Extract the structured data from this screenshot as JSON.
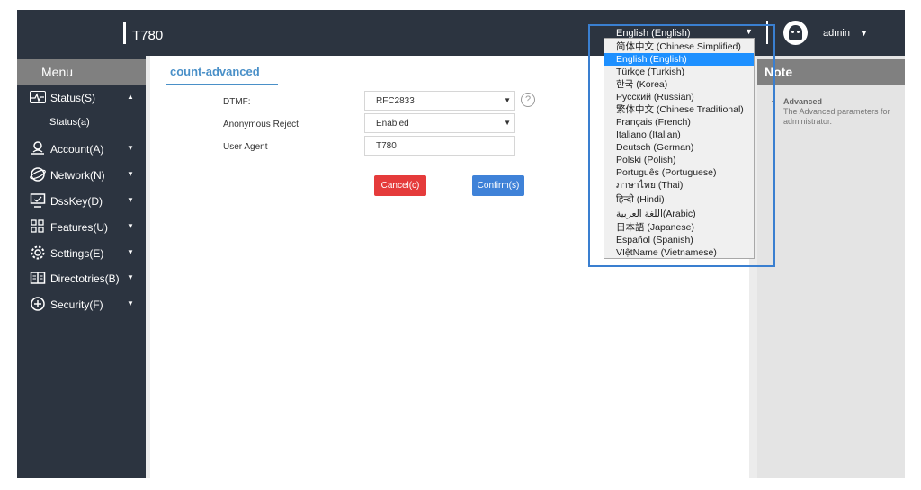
{
  "header": {
    "title": "T780",
    "language_selected": "English (English)",
    "user": "admin",
    "caret": "▼"
  },
  "sidebar": {
    "menu_title": "Menu",
    "items": [
      {
        "label": "Status(S)",
        "icon": "status-monitor-icon",
        "caret": "▲"
      },
      {
        "label": "Account(A)",
        "icon": "user-account-icon",
        "caret": "▼"
      },
      {
        "label": "Network(N)",
        "icon": "network-globe-icon",
        "caret": "▼"
      },
      {
        "label": "DssKey(D)",
        "icon": "dsskey-screen-icon",
        "caret": "▼"
      },
      {
        "label": "Features(U)",
        "icon": "features-grid-icon",
        "caret": "▼"
      },
      {
        "label": "Settings(E)",
        "icon": "gear-icon",
        "caret": "▼"
      },
      {
        "label": "Directotries(B)",
        "icon": "book-icon",
        "caret": "▼"
      },
      {
        "label": "Security(F)",
        "icon": "shield-plus-icon",
        "caret": "▼"
      }
    ],
    "sub_items": [
      "Status(a)"
    ]
  },
  "main": {
    "page_title": "count-advanced",
    "fields": [
      {
        "label": "DTMF:",
        "value": "RFC2833",
        "arrow": "▼"
      },
      {
        "label": "Anonymous Reject",
        "value": "Enabled",
        "arrow": "▼"
      },
      {
        "label": "User Agent",
        "value": "T780"
      }
    ],
    "help": "?",
    "cancel_label": "Cancel(c)",
    "confirm_label": "Confirm(s)"
  },
  "note": {
    "title": "Note",
    "heading": "Advanced",
    "text": "The Advanced parameters for administrator."
  },
  "language_dropdown": {
    "options": [
      "简体中文 (Chinese Simplified)",
      "English (English)",
      "Türkçe (Turkish)",
      "한국 (Korea)",
      "Русский (Russian)",
      "繁体中文 (Chinese Traditional)",
      "Français (French)",
      "Italiano (Italian)",
      "Deutsch (German)",
      "Polski (Polish)",
      "Português (Portuguese)",
      "ภาษาไทย (Thai)",
      "हिन्दी (Hindi)",
      "اللغة العربية(Arabic)",
      "日本語 (Japanese)",
      "Español (Spanish)",
      "VIệtName (Vietnamese)"
    ],
    "selected_index": 1
  },
  "colors": {
    "sidebar_bg": "#2c3440",
    "accent": "#4a90c8",
    "cancel": "#e53b3b",
    "confirm": "#3f82d8",
    "selected_option": "#1e90ff"
  }
}
